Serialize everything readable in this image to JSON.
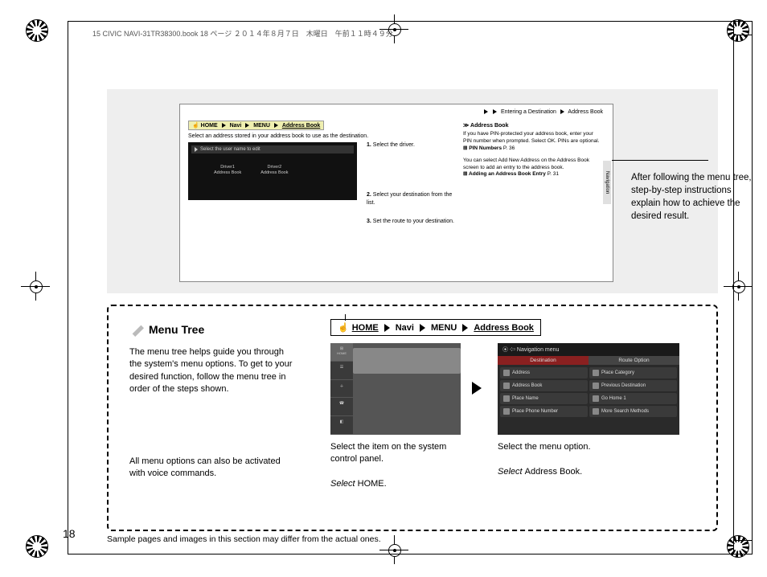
{
  "doc_header": "15 CIVIC NAVI-31TR38300.book  18 ページ  ２０１４年８月７日　木曜日　午前１１時４９分",
  "page_number": "18",
  "sample_note": "Sample pages and images in this section may differ from the actual ones.",
  "callout_text": "After following the menu tree, step-by-step instructions explain how to achieve the desired result.",
  "example": {
    "section_title": "Address Book",
    "breadcrumb_top": [
      "Entering a Destination",
      "Address Book"
    ],
    "mini_crumb": [
      "HOME",
      "Navi",
      "MENU",
      "Address Book"
    ],
    "intro": "Select an address stored in your address book to use as the destination.",
    "screen_prompt": "Select the user name to edit",
    "driver1_a": "Driver1",
    "driver1_b": "Address Book",
    "driver2_a": "Driver2",
    "driver2_b": "Address Book",
    "step1": "Select the driver.",
    "step2": "Select your destination from the list.",
    "step3": "Set the route to your destination.",
    "side_head": "Address Book",
    "side_p1": "If you have PIN-protected your address book, enter your PIN number when prompted. Select OK. PINs are optional.",
    "side_link1": "PIN Numbers",
    "side_pg1": "P. 36",
    "side_p2": "You can select Add New Address on the Address Book screen to add an entry to the address book.",
    "side_link2": "Adding an Address Book Entry",
    "side_pg2": "P. 31",
    "side_tab": "Navigation"
  },
  "menutree": {
    "heading": "Menu Tree",
    "para1": "The menu tree helps guide you through the system's menu options. To get to your desired function, follow the menu tree in order of the steps shown.",
    "para2": "All menu options can also be activated with voice commands.",
    "crumb": [
      "HOME",
      "Navi",
      "MENU",
      "Address Book"
    ],
    "home_label": "HOME",
    "nav_title": "Navigation menu",
    "nav_tab1": "Destination",
    "nav_tab2": "Route Option",
    "nav_items": [
      "Address",
      "Place Category",
      "Address Book",
      "Previous Destination",
      "Place Name",
      "Go Home 1",
      "Place Phone Number",
      "More Search Methods"
    ],
    "cap1a": "Select the item on the system control panel.",
    "cap1b_pre": "Select ",
    "cap1b_bold": "HOME",
    "cap2a": "Select the menu option.",
    "cap2b_pre": "Select ",
    "cap2b_bold": "Address Book"
  }
}
